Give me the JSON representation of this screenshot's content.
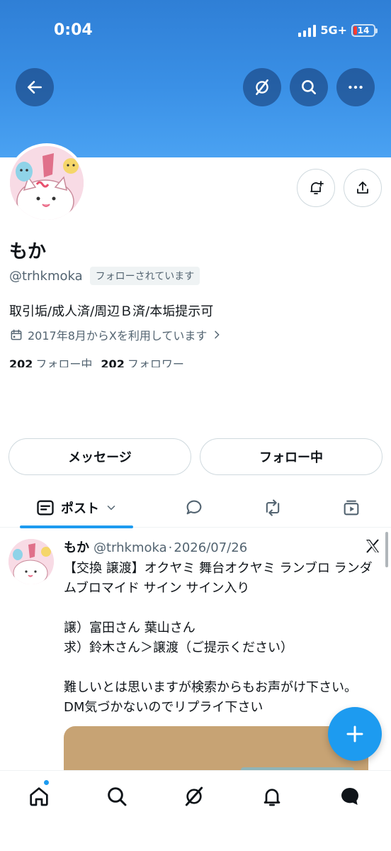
{
  "status_bar": {
    "time": "0:04",
    "network": "5G+",
    "battery": "14"
  },
  "header": {
    "back_icon": "arrow-left-icon",
    "grok_icon": "grok-icon",
    "search_icon": "search-icon",
    "more_icon": "more-horizontal-icon"
  },
  "profile": {
    "display_name": "もか",
    "handle": "@trhkmoka",
    "follows_you_badge": "フォローされています",
    "bio": "取引垢/成人済/周辺Ｂ済/本垢提示可",
    "joined": "2017年8月からXを利用しています",
    "following_count": "202",
    "following_label": "フォロー中",
    "followers_count": "202",
    "followers_label": "フォロワー"
  },
  "actions": {
    "message_label": "メッセージ",
    "following_label": "フォロー中"
  },
  "tabs": {
    "posts_label": "ポスト"
  },
  "tweet": {
    "name": "もか",
    "handle": "@trhkmoka",
    "separator": "·",
    "date": "2026/07/26",
    "text": "【交換 譲渡】オクヤミ 舞台オクヤミ ランブロ ランダムブロマイド サイン サイン入り\n\n譲）富田さん 葉山さん\n求）鈴木さん＞譲渡（ご提示ください）\n\n難しいとは思いますが検索からもお声がけ下さい。DM気づかないのでリプライ下さい"
  },
  "colors": {
    "accent": "#1d9bf0",
    "banner": "#3a90e6",
    "text_secondary": "#536471"
  }
}
